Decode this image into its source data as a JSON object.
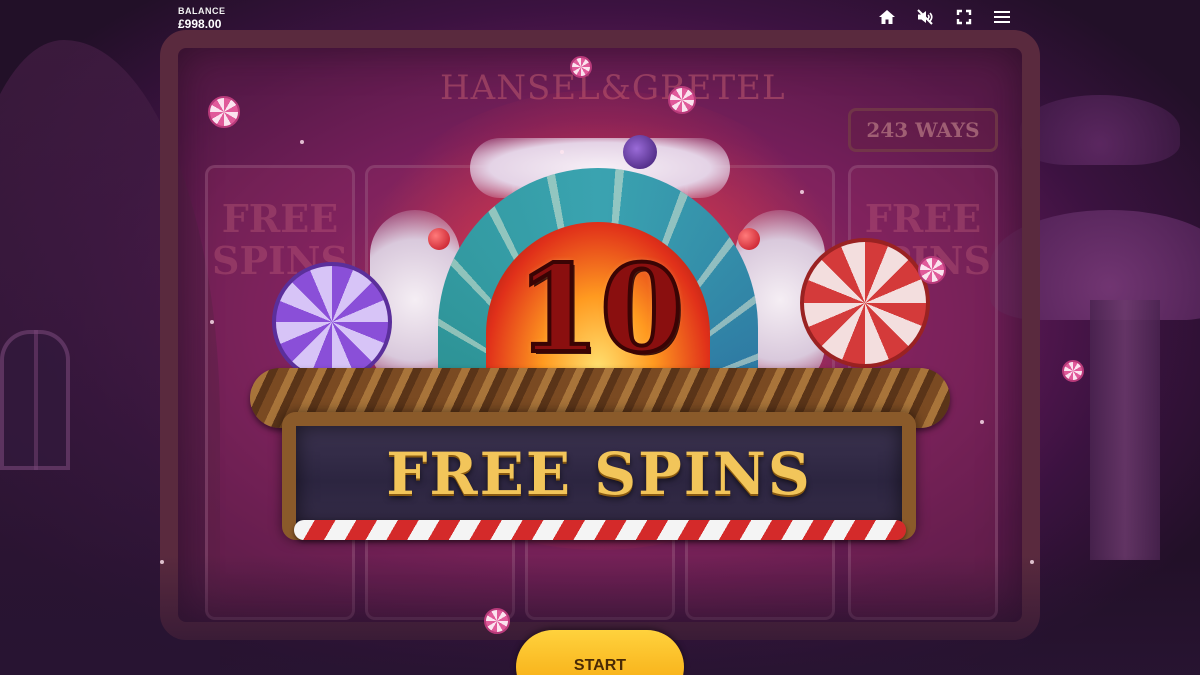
{
  "balance": {
    "label": "BALANCE",
    "value": "£998.00"
  },
  "toolbar": {
    "icons": [
      "home-icon",
      "sound-muted-icon",
      "fullscreen-icon",
      "menu-icon"
    ]
  },
  "game": {
    "title": "HANSEL&GRETEL",
    "ways": "243 WAYS",
    "reel_ghost_text": "FREE SPINS"
  },
  "dialog": {
    "count": "10",
    "label": "FREE SPINS",
    "start_label": "START"
  },
  "colors": {
    "accent_gold": "#f2c55a",
    "start_yellow": "#ffd23d",
    "number_red": "#8a0f0f"
  }
}
